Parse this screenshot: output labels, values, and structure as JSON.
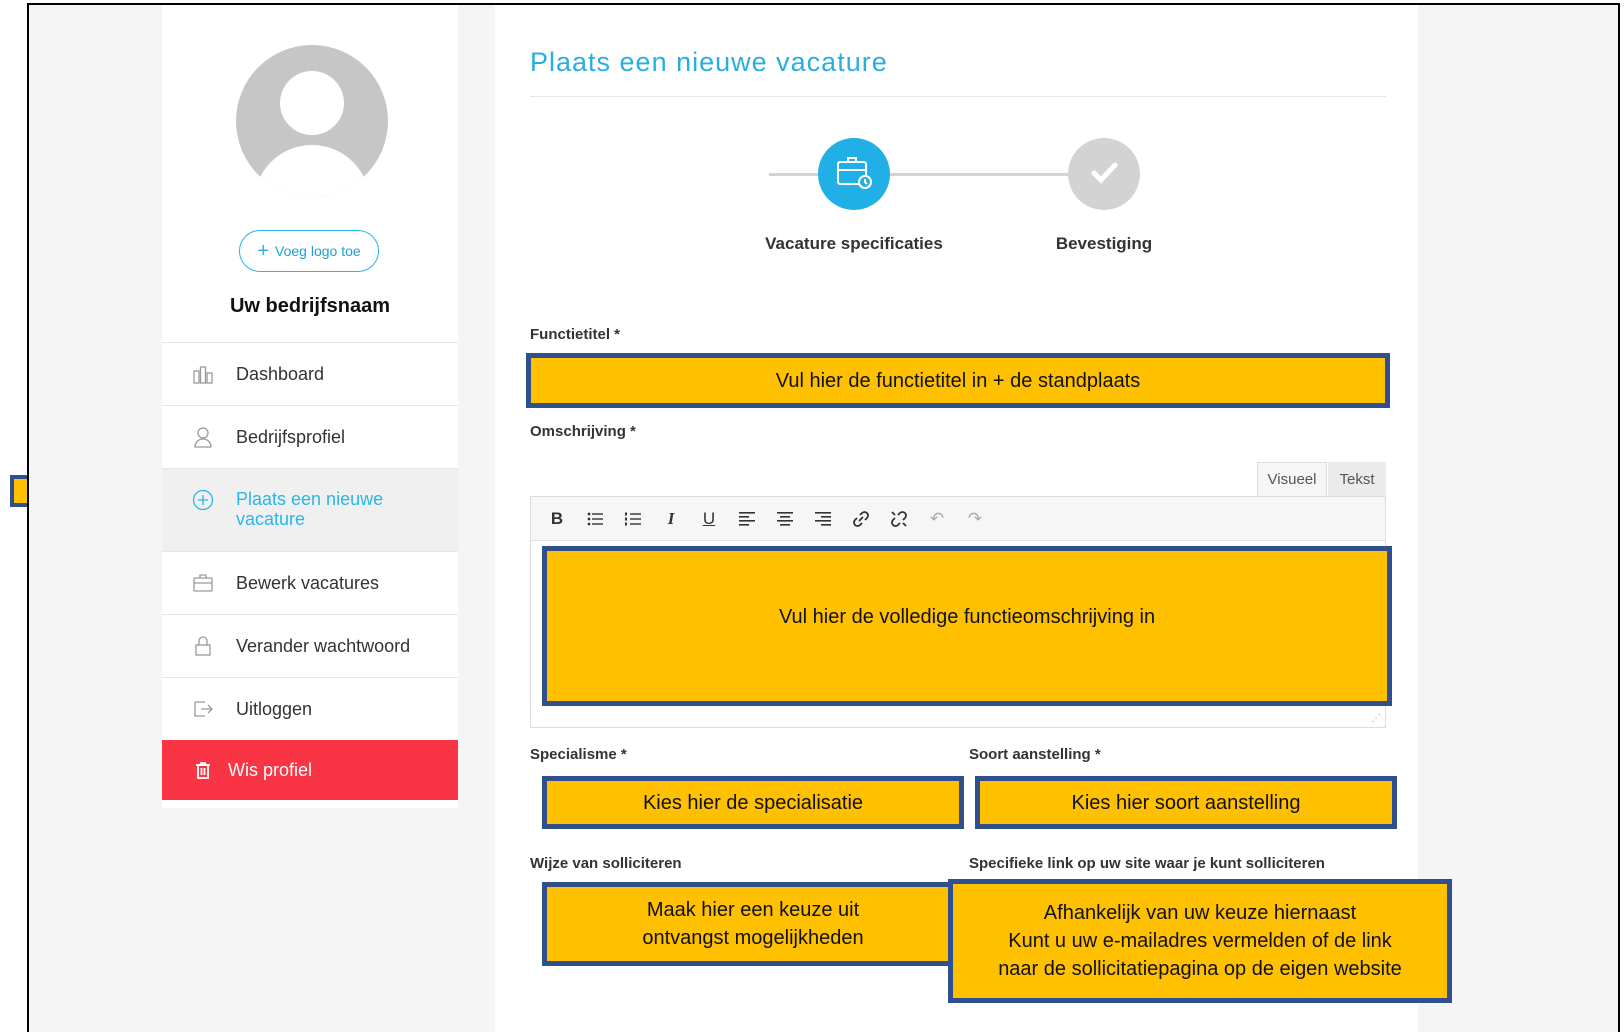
{
  "sidebar": {
    "add_logo_label": "Voeg logo toe",
    "company_name": "Uw bedrijfsnaam",
    "items": [
      {
        "label": "Dashboard",
        "icon": "dashboard-icon"
      },
      {
        "label": "Bedrijfsprofiel",
        "icon": "user-icon"
      },
      {
        "label": "Plaats een nieuwe vacature",
        "icon": "plus-circle-icon"
      },
      {
        "label": "Bewerk vacatures",
        "icon": "briefcase-icon"
      },
      {
        "label": "Verander wachtwoord",
        "icon": "lock-icon"
      },
      {
        "label": "Uitloggen",
        "icon": "logout-icon"
      }
    ],
    "delete_label": "Wis profiel"
  },
  "main": {
    "title": "Plaats een nieuwe vacature",
    "steps": [
      {
        "label": "Vacature specificaties",
        "state": "active"
      },
      {
        "label": "Bevestiging",
        "state": "pending"
      }
    ],
    "fields": {
      "functietitel_label": "Functietitel *",
      "omschrijving_label": "Omschrijving *",
      "specialisme_label": "Specialisme *",
      "soort_label": "Soort aanstelling *",
      "wijze_label": "Wijze van solliciteren",
      "link_label": "Specifieke link op uw site waar je kunt solliciteren"
    },
    "editor": {
      "tab_visual": "Visueel",
      "tab_text": "Tekst",
      "toolbar": [
        "bold",
        "bullet-list",
        "numbered-list",
        "italic",
        "underline",
        "align-left",
        "align-center",
        "align-right",
        "link",
        "unlink",
        "undo",
        "redo"
      ]
    }
  },
  "annotations": {
    "functietitel": "Vul hier de functietitel in +  de standplaats",
    "omschrijving": "Vul hier de volledige functieomschrijving in",
    "specialisme": "Kies hier de specialisatie",
    "soort": "Kies hier soort aanstelling",
    "wijze_line1": "Maak hier een keuze uit",
    "wijze_line2": "ontvangst mogelijkheden",
    "link_line1": "Afhankelijk van uw keuze hiernaast",
    "link_line2": "Kunt u uw e-mailadres vermelden of de  link",
    "link_line3": "naar de sollicitatiepagina op de eigen website"
  },
  "colors": {
    "accent": "#29aee0",
    "danger": "#f93545",
    "annotation_fill": "#ffc000",
    "annotation_border": "#2f4f8f"
  }
}
